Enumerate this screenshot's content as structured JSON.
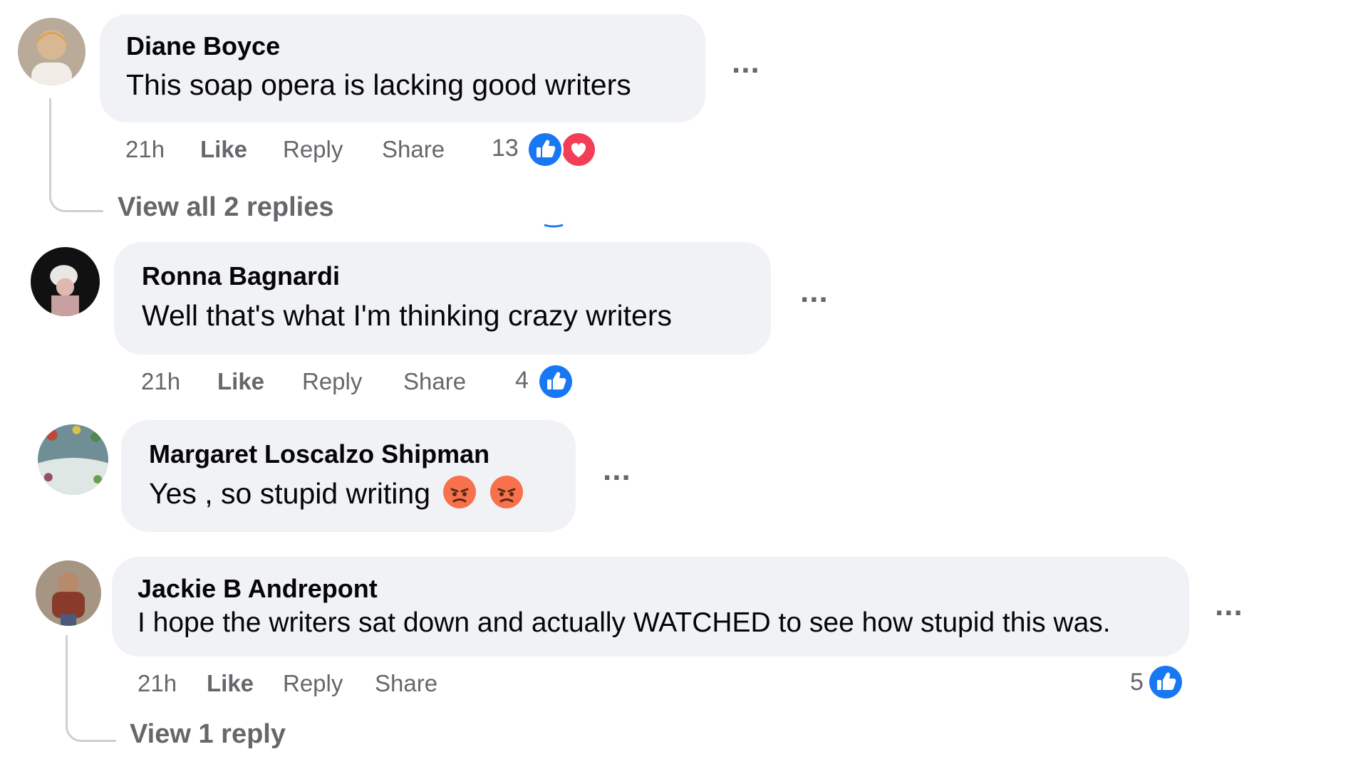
{
  "comments": [
    {
      "author": "Diane Boyce",
      "text": "This soap opera is lacking good writers",
      "time": "21h",
      "like": "Like",
      "reply": "Reply",
      "share": "Share",
      "reaction_count": "13",
      "reactions": [
        "like-icon",
        "love-icon"
      ],
      "view_replies": "View all 2 replies"
    },
    {
      "author": "Ronna Bagnardi",
      "text": "Well that's what I'm thinking crazy writers",
      "time": "21h",
      "like": "Like",
      "reply": "Reply",
      "share": "Share",
      "reaction_count": "4",
      "reactions": [
        "like-icon"
      ]
    },
    {
      "author": "Margaret Loscalzo Shipman",
      "text": "Yes , so stupid writing",
      "emojis": [
        "angry-face-emoji",
        "angry-face-emoji"
      ]
    },
    {
      "author": "Jackie B Andrepont",
      "text": "I hope the writers sat down and actually WATCHED to see how stupid this was.",
      "time": "21h",
      "like": "Like",
      "reply": "Reply",
      "share": "Share",
      "reaction_count": "5",
      "reactions": [
        "like-icon"
      ],
      "view_replies": "View 1 reply"
    }
  ],
  "more_label": "...",
  "colors": {
    "bubble": "#f0f2f5",
    "secondary_text": "#65676b",
    "like_blue": "#1877f2",
    "love_red": "#f33e58",
    "angry_orange": "#f7714c"
  }
}
